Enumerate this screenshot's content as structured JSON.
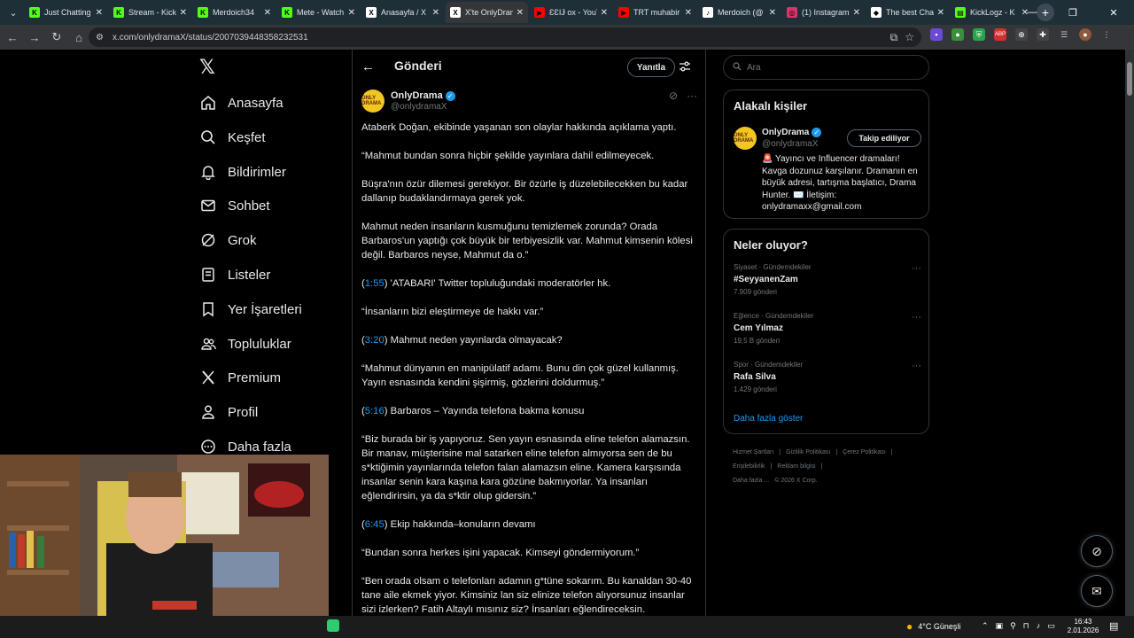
{
  "browser": {
    "tabs": [
      {
        "title": "Just Chatting",
        "color": "#53fc18",
        "glyph": "K"
      },
      {
        "title": "Stream - Kick",
        "color": "#53fc18",
        "glyph": "K"
      },
      {
        "title": "Merdoich34",
        "color": "#53fc18",
        "glyph": "K"
      },
      {
        "title": "Mete - Watch",
        "color": "#53fc18",
        "glyph": "K"
      },
      {
        "title": "Anasayfa / X",
        "color": "#ffffff",
        "glyph": "X"
      },
      {
        "title": "X'te OnlyDrama",
        "color": "#ffffff",
        "glyph": "X"
      },
      {
        "title": "ƐƐIɈ ox - YouTube",
        "color": "#ff0000",
        "glyph": "▶"
      },
      {
        "title": "TRT muhabir",
        "color": "#ff0000",
        "glyph": "▶"
      },
      {
        "title": "Merdoich (@",
        "color": "#ffffff",
        "glyph": "♪"
      },
      {
        "title": "(1) Instagram",
        "color": "#e1306c",
        "glyph": "◎"
      },
      {
        "title": "The best Chat",
        "color": "#ffffff",
        "glyph": "◆"
      },
      {
        "title": "KickLogz - K",
        "color": "#53fc18",
        "glyph": "▤"
      }
    ],
    "active_tab": 5,
    "url": "x.com/onlydramaX/status/2007039448358232531"
  },
  "left_nav": {
    "items": [
      {
        "label": "Anasayfa",
        "icon": "home-icon"
      },
      {
        "label": "Keşfet",
        "icon": "search-icon"
      },
      {
        "label": "Bildirimler",
        "icon": "bell-icon"
      },
      {
        "label": "Sohbet",
        "icon": "mail-icon"
      },
      {
        "label": "Grok",
        "icon": "grok-icon"
      },
      {
        "label": "Listeler",
        "icon": "list-icon"
      },
      {
        "label": "Yer İşaretleri",
        "icon": "bookmark-icon"
      },
      {
        "label": "Topluluklar",
        "icon": "people-icon"
      },
      {
        "label": "Premium",
        "icon": "x-icon"
      },
      {
        "label": "Profil",
        "icon": "person-icon"
      },
      {
        "label": "Daha fazla",
        "icon": "more-circle-icon"
      }
    ]
  },
  "main": {
    "title": "Gönderi",
    "reply_label": "Yanıtla",
    "post": {
      "author": "OnlyDrama",
      "handle": "@onlydramaX",
      "avatar_text": "ONLY DRAMA",
      "paragraphs": [
        {
          "ts": "",
          "text": "Ataberk Doğan, ekibinde yaşanan son olaylar hakkında açıklama yaptı."
        },
        {
          "ts": "",
          "text": "“Mahmut bundan sonra hiçbir şekilde yayınlara dahil edilmeyecek."
        },
        {
          "ts": "",
          "text": "Büşra'nın özür dilemesi gerekiyor. Bir özürle iş düzelebilecekken bu kadar dallanıp budaklandırmaya gerek yok."
        },
        {
          "ts": "",
          "text": "Mahmut neden insanların kusmuğunu temizlemek zorunda? Orada Barbaros'un yaptığı çok büyük bir terbiyesizlik var. Mahmut kimsenin kölesi değil. Barbaros neyse, Mahmut da o.”"
        },
        {
          "ts": "1:55",
          "text": "'ATABARI' Twitter topluluğundaki moderatörler hk."
        },
        {
          "ts": "",
          "text": "“İnsanların bizi eleştirmeye de hakkı var.”"
        },
        {
          "ts": "3:20",
          "text": "Mahmut neden yayınlarda olmayacak?"
        },
        {
          "ts": "",
          "text": "“Mahmut dünyanın en manipülatif adamı. Bunu din çok güzel kullanmış. Yayın esnasında kendini şişirmiş, gözlerini doldurmuş.”"
        },
        {
          "ts": "5:16",
          "text": "Barbaros – Yayında telefona bakma konusu"
        },
        {
          "ts": "",
          "text": "“Biz burada bir iş yapıyoruz. Sen yayın esnasında eline telefon alamazsın. Bir manav, müşterisine mal satarken eline telefon almıyorsa sen de bu s*ktiğimin yayınlarında telefon falan alamazsın eline. Kamera karşısında insanlar senin kara kaşına kara gözüne bakmıyorlar. Ya insanları eğlendirirsin, ya da s*ktir olup gidersin.”"
        },
        {
          "ts": "6:45",
          "text": "Ekip hakkında–konuların devamı"
        },
        {
          "ts": "",
          "text": "“Bundan sonra herkes işini yapacak. Kimseyi göndermiyorum.”"
        },
        {
          "ts": "",
          "text": "“Ben orada olsam o telefonları adamın g*tüne sokarım. Bu kanaldan 30-40 tane aile ekmek yiyor. Kimsiniz lan siz elinize telefon alıyorsunuz insanlar sizi izlerken? Fatih Altaylı mısınız siz? İnsanları eğlendireceksin."
        }
      ]
    }
  },
  "right": {
    "search_placeholder": "Ara",
    "related_title": "Alakalı kişiler",
    "related": {
      "name": "OnlyDrama",
      "handle": "@onlydramaX",
      "follow_label": "Takip ediliyor",
      "bio": "🚨 Yayıncı ve Influencer dramaları! Kavga dozunuz karşılanır. Dramanın en büyük adresi, tartışma başlatıcı, Drama Hunter. ✉️ İletişim: onlydramaxx@gmail.com"
    },
    "trends_title": "Neler oluyor?",
    "trends": [
      {
        "category": "Siyaset · Gündemdekiler",
        "name": "#SeyyanenZam",
        "count": "7.909 gönderi"
      },
      {
        "category": "Eğlence · Gündemdekiler",
        "name": "Cem Yılmaz",
        "count": "19,5 B gönderi"
      },
      {
        "category": "Spor · Gündemdekiler",
        "name": "Rafa Silva",
        "count": "1.429 gönderi"
      }
    ],
    "show_more": "Daha fazla göster",
    "footer": [
      "Hizmet Şartları",
      "|",
      "Gizlilik Politikası",
      "|",
      "Çerez Politikası",
      "|",
      "Erişilebilirlik",
      "|",
      "Reklam bilgisi",
      "|",
      "Daha fazla ...",
      "© 2026 X Corp."
    ]
  },
  "taskbar": {
    "weather": "4°C  Güneşli",
    "time": "16:43",
    "date": "2.01.2026"
  },
  "colors": {
    "accent": "#1d9bf0",
    "background": "#000000",
    "text": "#e7e9ea",
    "muted": "#71767b",
    "border": "#2f3336"
  }
}
